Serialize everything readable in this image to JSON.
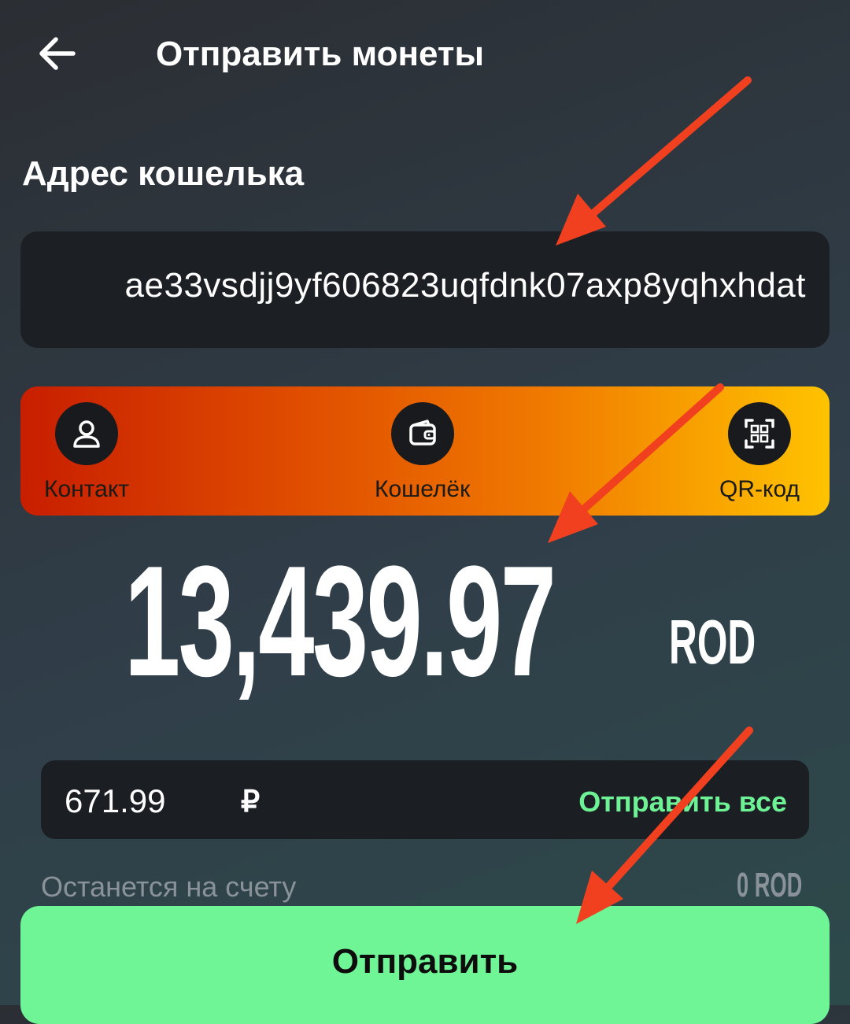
{
  "header": {
    "title": "Отправить монеты",
    "back_icon": "arrow-left-icon"
  },
  "wallet": {
    "label": "Адрес кошелька",
    "address_value": "ae33vsdjj9yf606823uqfdnk07axp8yqhxhdat"
  },
  "sources": [
    {
      "label": "Контакт",
      "icon": "person-icon"
    },
    {
      "label": "Кошелёк",
      "icon": "wallet-icon"
    },
    {
      "label": "QR-код",
      "icon": "qr-code-icon"
    }
  ],
  "amount": {
    "value": "13,439.97",
    "currency": "ROD"
  },
  "fiat": {
    "value": "671.99",
    "symbol": "₽",
    "send_all_label": "Отправить все"
  },
  "remaining": {
    "label": "Останется на счету",
    "value": "0 ROD"
  },
  "send_button": {
    "label": "Отправить"
  },
  "colors": {
    "accent_green": "#6ff595",
    "annotation_red": "#f0401f",
    "gradient_start": "#c81e00",
    "gradient_end": "#ffc300"
  }
}
